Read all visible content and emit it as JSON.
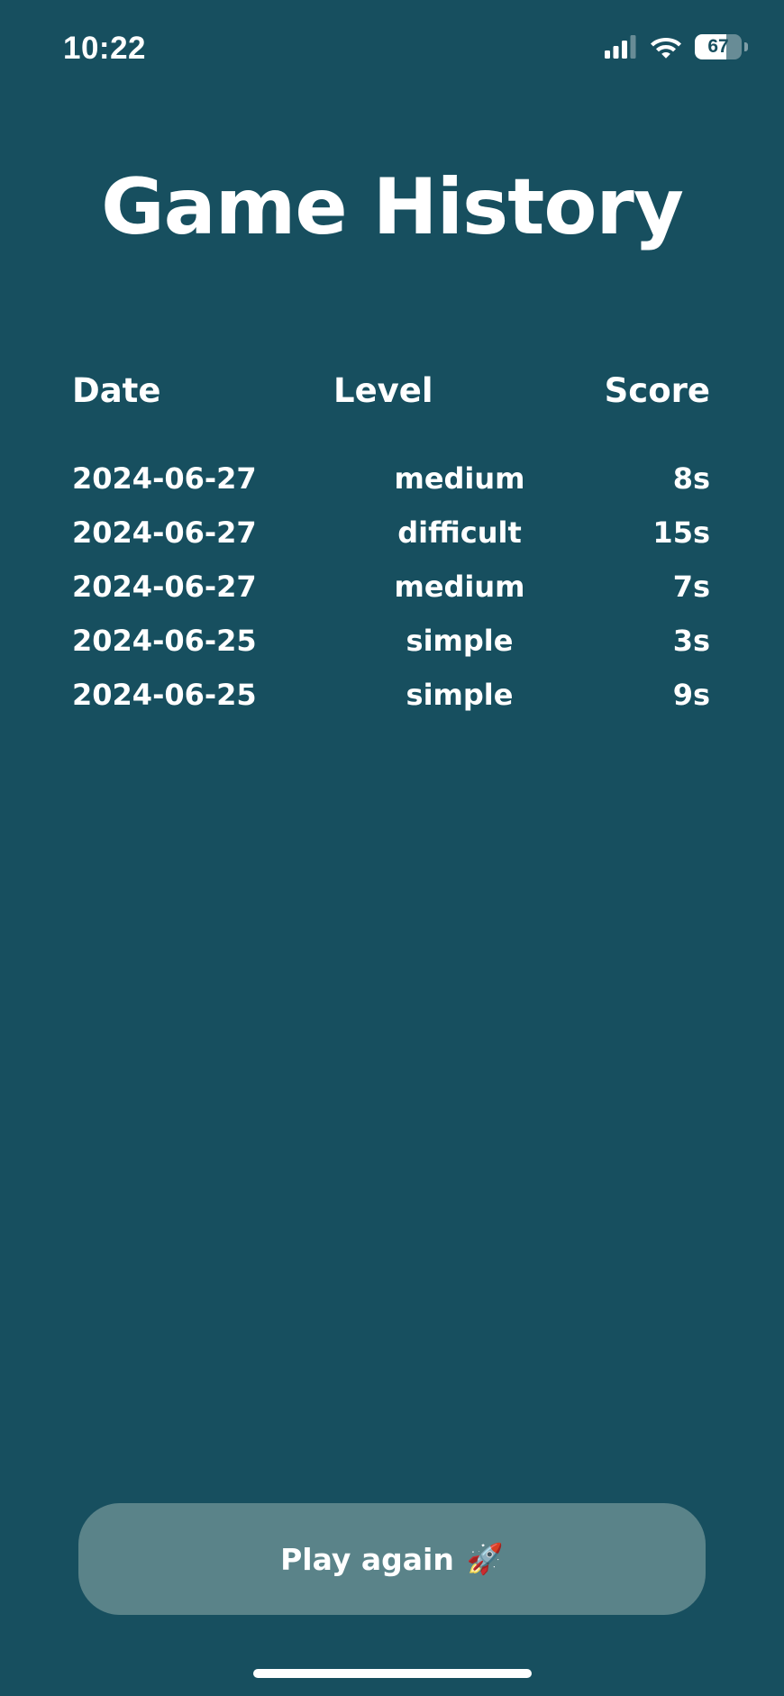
{
  "status_bar": {
    "time": "10:22",
    "battery_level": "67",
    "battery_fraction": 0.67,
    "icons": [
      "cellular-signal-icon",
      "wifi-icon",
      "battery-icon"
    ]
  },
  "title": "Game History",
  "table": {
    "headers": {
      "date": "Date",
      "level": "Level",
      "score": "Score"
    },
    "rows": [
      {
        "date": "2024-06-27",
        "level": "medium",
        "score": "8s"
      },
      {
        "date": "2024-06-27",
        "level": "difficult",
        "score": "15s"
      },
      {
        "date": "2024-06-27",
        "level": "medium",
        "score": "7s"
      },
      {
        "date": "2024-06-25",
        "level": "simple",
        "score": "3s"
      },
      {
        "date": "2024-06-25",
        "level": "simple",
        "score": "9s"
      }
    ]
  },
  "play_button": {
    "label": "Play again",
    "icon": "rocket-icon",
    "emoji": "🚀"
  },
  "colors": {
    "background": "#174f5f",
    "button": "#5a8389",
    "text": "#ffffff"
  }
}
